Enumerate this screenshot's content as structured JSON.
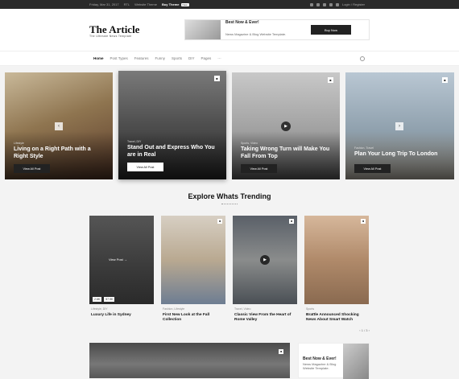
{
  "topbar": {
    "date": "Friday, Mar 31, 2017",
    "rtl": "RTL",
    "website_theme": "Website Theme",
    "buy_theme": "Buy Theme",
    "badge": "New",
    "login": "Login / Register"
  },
  "header": {
    "logo": "The Article",
    "tagline": "The Ultimate News Template"
  },
  "ad": {
    "title": "Best Now & Ever!",
    "text": "News Magazine & Blog Website Template.",
    "button": "Buy Now"
  },
  "nav": {
    "items": [
      "Home",
      "Post Types",
      "Features",
      "Funny",
      "Sports",
      "DIY",
      "Pages",
      "⋯"
    ]
  },
  "slides": [
    {
      "cat": "Lifestyle",
      "title": "Living on a Right Path with a Right Style",
      "button": "View All Post"
    },
    {
      "cat": "Travel, DIY",
      "title": "Stand Out and Express Who You are in Real",
      "button": "View All Post"
    },
    {
      "cat": "Sports, Video",
      "title": "Taking Wrong Turn will Make You Fall From Top",
      "button": "View All Post"
    },
    {
      "cat": "Fashion, Travel",
      "title": "Plan Your Long Trip To London",
      "button": "View All Post"
    }
  ],
  "trending": {
    "title": "Explore Whats Trending",
    "cards": [
      {
        "cat": "Lifestyle, DIY",
        "title": "Luxury Life in Sydney",
        "views": "2.6K",
        "comments": "57.9K",
        "view_post": "View Post →"
      },
      {
        "cat": "Fashion, Lifestyle",
        "title": "First New Look at the Fall Collection"
      },
      {
        "cat": "Travel, Video",
        "title": "Classic View From the Heart of Rome Valley"
      },
      {
        "cat": "Sports",
        "title": "Brattle Announced Shocking News About Smart Watch"
      }
    ],
    "pager": "1 / 3"
  },
  "bottom_ad": {
    "title": "Best Now & Ever!",
    "text": "News Magazine & Blog Website Template."
  }
}
